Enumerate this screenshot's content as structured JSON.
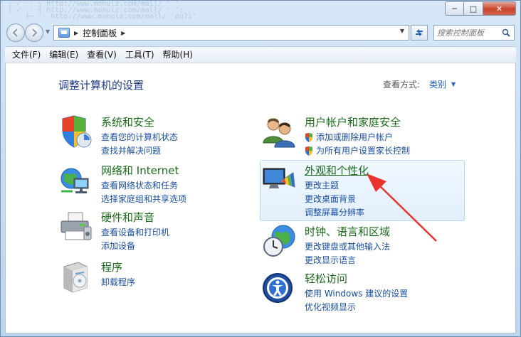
{
  "window": {
    "title": "控制面板",
    "buttons": {
      "minimize": "─",
      "maximize": "□",
      "close": "✕"
    }
  },
  "address": {
    "crumb": "控制面板",
    "search_placeholder": "搜索控制面板"
  },
  "menu": [
    "文件(F)",
    "编辑(E)",
    "查看(V)",
    "工具(T)",
    "帮助(H)"
  ],
  "main": {
    "heading": "调整计算机的设置",
    "view_by_label": "查看方式:",
    "view_by_value": "类别"
  },
  "categories": [
    {
      "id": "system-security",
      "title": "系统和安全",
      "icon": "shield-icon",
      "links": [
        "查看您的计算机状态",
        "查找并解决问题"
      ]
    },
    {
      "id": "network",
      "title": "网络和 Internet",
      "icon": "network-globe-icon",
      "links": [
        "查看网络状态和任务",
        "选择家庭组和共享选项"
      ]
    },
    {
      "id": "hardware-sound",
      "title": "硬件和声音",
      "icon": "printer-icon",
      "links": [
        "查看设备和打印机",
        "添加设备"
      ]
    },
    {
      "id": "programs",
      "title": "程序",
      "icon": "programs-box-icon",
      "links": [
        "卸载程序"
      ]
    },
    {
      "id": "user-accounts",
      "title": "用户帐户和家庭安全",
      "icon": "users-icon",
      "links": [
        "添加或删除用户帐户",
        "为所有用户设置家长控制"
      ],
      "link_shields": true
    },
    {
      "id": "appearance",
      "title": "外观和个性化",
      "icon": "display-palette-icon",
      "links": [
        "更改主题",
        "更改桌面背景",
        "调整屏幕分辨率"
      ]
    },
    {
      "id": "clock-region",
      "title": "时钟、语言和区域",
      "icon": "clock-globe-icon",
      "links": [
        "更改键盘或其他输入法",
        "更改显示语言"
      ]
    },
    {
      "id": "ease-of-access",
      "title": "轻松访问",
      "icon": "ease-of-access-icon",
      "links": [
        "使用 Windows 建议的设置",
        "优化视频显示"
      ]
    }
  ],
  "colors": {
    "category_title": "#1b6b1b",
    "link": "#1a4fa0",
    "heading": "#1e3a8a",
    "annotation_arrow": "#e8332f"
  }
}
